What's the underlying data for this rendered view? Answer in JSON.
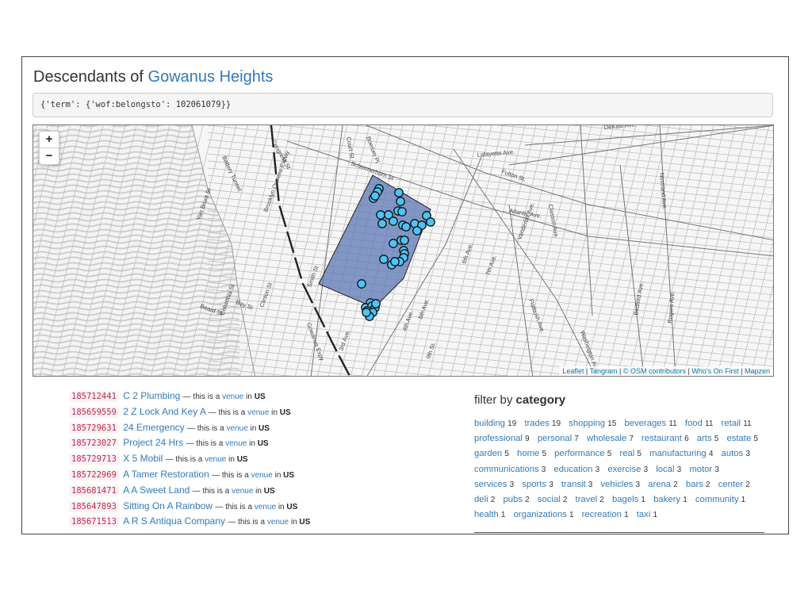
{
  "header": {
    "title_prefix": "Descendants of",
    "title_link": "Gowanus Heights"
  },
  "query": "{'term': {'wof:belongsto': 102061079}}",
  "map": {
    "zoom_in": "+",
    "zoom_out": "−",
    "attribution": [
      {
        "label": "Leaflet"
      },
      {
        "label": "Tangram"
      },
      {
        "label": "© OSM contributors"
      },
      {
        "label": "Who's On First"
      },
      {
        "label": "Mapzen"
      }
    ],
    "polygon_color": "#5b77b4",
    "marker_color": "#4fc3f7",
    "street_labels": [
      "DeKalb Ave.",
      "Lafayette Ave.",
      "Fulton St.",
      "Atlantic Ave.",
      "Schermerhorn St",
      "Congress St",
      "Court St",
      "Boerum Pl",
      "Van Brunt St",
      "Columbia St",
      "Bay St",
      "Clinton St",
      "Smith St",
      "3rd Ave.",
      "4th Ave.",
      "5th Ave.",
      "6th Ave.",
      "7th Ave.",
      "9th St.",
      "Flatbush Ave.",
      "Vanderbilt Ave.",
      "Washington Ave.",
      "Classon Ave.",
      "Bedford Ave.",
      "Nostrand Ave.",
      "Rogers Ave.",
      "Gowanus Expy",
      "Brooklyn Queens Expwy",
      "Battery Tunnel",
      "Beard St"
    ]
  },
  "venues": [
    {
      "id": "185712441",
      "name": "C 2 Plumbing",
      "pre": "— this is a",
      "type": "venue",
      "mid": "in",
      "country": "US"
    },
    {
      "id": "185659559",
      "name": "2 Z Lock And Key A",
      "pre": "— this is a",
      "type": "venue",
      "mid": "in",
      "country": "US"
    },
    {
      "id": "185729631",
      "name": "24 Emergency",
      "pre": "— this is a",
      "type": "venue",
      "mid": "in",
      "country": "US"
    },
    {
      "id": "185723027",
      "name": "Project 24 Hrs",
      "pre": "— this is a",
      "type": "venue",
      "mid": "in",
      "country": "US"
    },
    {
      "id": "185729713",
      "name": "X 5 Mobil",
      "pre": "— this is a",
      "type": "venue",
      "mid": "in",
      "country": "US"
    },
    {
      "id": "185722969",
      "name": "A Tamer Restoration",
      "pre": "— this is a",
      "type": "venue",
      "mid": "in",
      "country": "US"
    },
    {
      "id": "185681471",
      "name": "A A Sweet Land",
      "pre": "— this is a",
      "type": "venue",
      "mid": "in",
      "country": "US"
    },
    {
      "id": "185647893",
      "name": "Sitting On A Rainbow",
      "pre": "— this is a",
      "type": "venue",
      "mid": "in",
      "country": "US"
    },
    {
      "id": "185671513",
      "name": "A R S Antiqua Company",
      "pre": "— this is a",
      "type": "venue",
      "mid": "in",
      "country": "US"
    }
  ],
  "filter": {
    "heading_prefix": "filter by",
    "heading_bold": "category",
    "categories": [
      {
        "name": "building",
        "count": 19
      },
      {
        "name": "trades",
        "count": 19
      },
      {
        "name": "shopping",
        "count": 15
      },
      {
        "name": "beverages",
        "count": 11
      },
      {
        "name": "food",
        "count": 11
      },
      {
        "name": "retail",
        "count": 11
      },
      {
        "name": "professional",
        "count": 9
      },
      {
        "name": "personal",
        "count": 7
      },
      {
        "name": "wholesale",
        "count": 7
      },
      {
        "name": "restaurant",
        "count": 6
      },
      {
        "name": "arts",
        "count": 5
      },
      {
        "name": "estate",
        "count": 5
      },
      {
        "name": "garden",
        "count": 5
      },
      {
        "name": "home",
        "count": 5
      },
      {
        "name": "performance",
        "count": 5
      },
      {
        "name": "real",
        "count": 5
      },
      {
        "name": "manufacturing",
        "count": 4
      },
      {
        "name": "autos",
        "count": 3
      },
      {
        "name": "communications",
        "count": 3
      },
      {
        "name": "education",
        "count": 3
      },
      {
        "name": "exercise",
        "count": 3
      },
      {
        "name": "local",
        "count": 3
      },
      {
        "name": "motor",
        "count": 3
      },
      {
        "name": "services",
        "count": 3
      },
      {
        "name": "sports",
        "count": 3
      },
      {
        "name": "transit",
        "count": 3
      },
      {
        "name": "vehicles",
        "count": 3
      },
      {
        "name": "arena",
        "count": 2
      },
      {
        "name": "bars",
        "count": 2
      },
      {
        "name": "center",
        "count": 2
      },
      {
        "name": "deli",
        "count": 2
      },
      {
        "name": "pubs",
        "count": 2
      },
      {
        "name": "social",
        "count": 2
      },
      {
        "name": "travel",
        "count": 2
      },
      {
        "name": "bagels",
        "count": 1
      },
      {
        "name": "bakery",
        "count": 1
      },
      {
        "name": "community",
        "count": 1
      },
      {
        "name": "health",
        "count": 1
      },
      {
        "name": "organizations",
        "count": 1
      },
      {
        "name": "recreation",
        "count": 1
      },
      {
        "name": "taxi",
        "count": 1
      }
    ]
  }
}
